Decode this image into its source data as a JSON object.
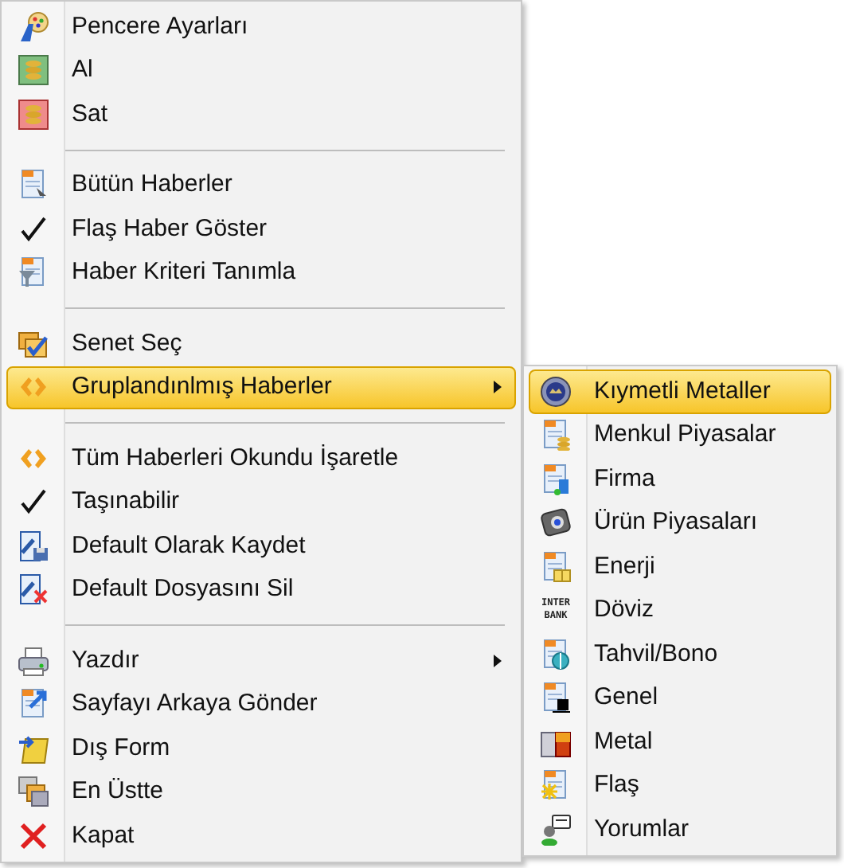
{
  "menu": {
    "items": [
      {
        "kind": "item",
        "label": "Pencere Ayarları",
        "checked": false,
        "selected": false,
        "has_submenu": false
      },
      {
        "kind": "item",
        "label": "Al",
        "checked": false,
        "selected": false,
        "has_submenu": false
      },
      {
        "kind": "item",
        "label": "Sat",
        "checked": false,
        "selected": false,
        "has_submenu": false
      },
      {
        "kind": "separator"
      },
      {
        "kind": "item",
        "label": "Bütün Haberler",
        "checked": false,
        "selected": false,
        "has_submenu": false
      },
      {
        "kind": "item",
        "label": "Flaş Haber Göster",
        "checked": true,
        "selected": false,
        "has_submenu": false
      },
      {
        "kind": "item",
        "label": "Haber Kriteri Tanımla",
        "checked": false,
        "selected": false,
        "has_submenu": false
      },
      {
        "kind": "separator"
      },
      {
        "kind": "item",
        "label": "Senet Seç",
        "checked": false,
        "selected": false,
        "has_submenu": false
      },
      {
        "kind": "item",
        "label": "Gruplandınlmış Haberler",
        "checked": false,
        "selected": true,
        "has_submenu": true
      },
      {
        "kind": "separator"
      },
      {
        "kind": "item",
        "label": "Tüm Haberleri Okundu İşaretle",
        "checked": false,
        "selected": false,
        "has_submenu": false
      },
      {
        "kind": "item",
        "label": "Taşınabilir",
        "checked": true,
        "selected": false,
        "has_submenu": false
      },
      {
        "kind": "item",
        "label": "Default Olarak Kaydet",
        "checked": false,
        "selected": false,
        "has_submenu": false
      },
      {
        "kind": "item",
        "label": "Default Dosyasını Sil",
        "checked": false,
        "selected": false,
        "has_submenu": false
      },
      {
        "kind": "separator"
      },
      {
        "kind": "item",
        "label": "Yazdır",
        "checked": false,
        "selected": false,
        "has_submenu": true
      },
      {
        "kind": "item",
        "label": "Sayfayı Arkaya Gönder",
        "checked": false,
        "selected": false,
        "has_submenu": false
      },
      {
        "kind": "item",
        "label": "Dış Form",
        "checked": false,
        "selected": false,
        "has_submenu": false
      },
      {
        "kind": "item",
        "label": "En Üstte",
        "checked": false,
        "selected": false,
        "has_submenu": false
      },
      {
        "kind": "item",
        "label": "Kapat",
        "checked": false,
        "selected": false,
        "has_submenu": false
      }
    ]
  },
  "submenu": {
    "items": [
      {
        "label": "Kıymetli Metaller",
        "selected": true
      },
      {
        "label": "Menkul Piyasalar",
        "selected": false
      },
      {
        "label": "Firma",
        "selected": false
      },
      {
        "label": "Ürün Piyasaları",
        "selected": false
      },
      {
        "label": "Enerji",
        "selected": false
      },
      {
        "label": "Döviz",
        "selected": false,
        "icon_text": "INTER BANK"
      },
      {
        "label": "Tahvil/Bono",
        "selected": false
      },
      {
        "label": "Genel",
        "selected": false
      },
      {
        "label": "Metal",
        "selected": false
      },
      {
        "label": "Flaş",
        "selected": false
      },
      {
        "label": "Yorumlar",
        "selected": false
      }
    ]
  }
}
